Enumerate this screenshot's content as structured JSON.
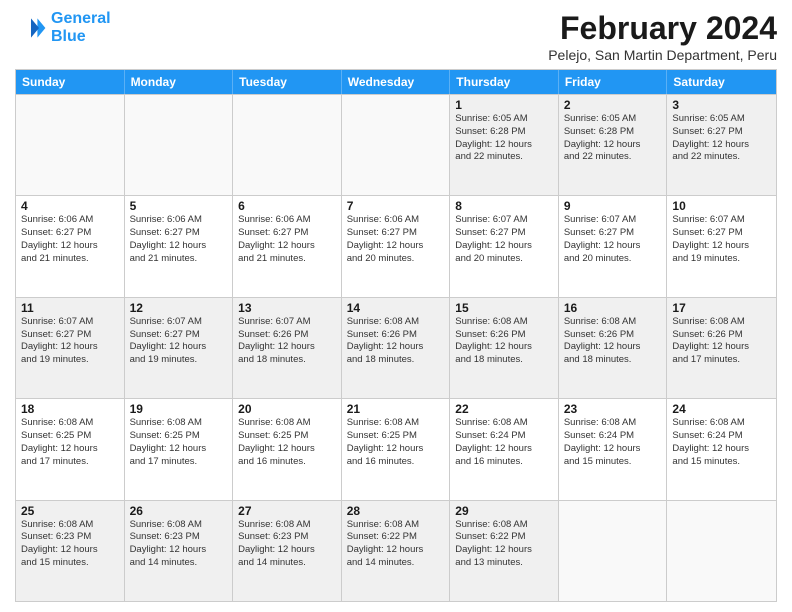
{
  "logo": {
    "line1": "General",
    "line2": "Blue"
  },
  "title": "February 2024",
  "subtitle": "Pelejo, San Martin Department, Peru",
  "weekdays": [
    "Sunday",
    "Monday",
    "Tuesday",
    "Wednesday",
    "Thursday",
    "Friday",
    "Saturday"
  ],
  "weeks": [
    [
      {
        "day": "",
        "info": "",
        "empty": true
      },
      {
        "day": "",
        "info": "",
        "empty": true
      },
      {
        "day": "",
        "info": "",
        "empty": true
      },
      {
        "day": "",
        "info": "",
        "empty": true
      },
      {
        "day": "1",
        "info": "Sunrise: 6:05 AM\nSunset: 6:28 PM\nDaylight: 12 hours\nand 22 minutes."
      },
      {
        "day": "2",
        "info": "Sunrise: 6:05 AM\nSunset: 6:28 PM\nDaylight: 12 hours\nand 22 minutes."
      },
      {
        "day": "3",
        "info": "Sunrise: 6:05 AM\nSunset: 6:27 PM\nDaylight: 12 hours\nand 22 minutes."
      }
    ],
    [
      {
        "day": "4",
        "info": "Sunrise: 6:06 AM\nSunset: 6:27 PM\nDaylight: 12 hours\nand 21 minutes."
      },
      {
        "day": "5",
        "info": "Sunrise: 6:06 AM\nSunset: 6:27 PM\nDaylight: 12 hours\nand 21 minutes."
      },
      {
        "day": "6",
        "info": "Sunrise: 6:06 AM\nSunset: 6:27 PM\nDaylight: 12 hours\nand 21 minutes."
      },
      {
        "day": "7",
        "info": "Sunrise: 6:06 AM\nSunset: 6:27 PM\nDaylight: 12 hours\nand 20 minutes."
      },
      {
        "day": "8",
        "info": "Sunrise: 6:07 AM\nSunset: 6:27 PM\nDaylight: 12 hours\nand 20 minutes."
      },
      {
        "day": "9",
        "info": "Sunrise: 6:07 AM\nSunset: 6:27 PM\nDaylight: 12 hours\nand 20 minutes."
      },
      {
        "day": "10",
        "info": "Sunrise: 6:07 AM\nSunset: 6:27 PM\nDaylight: 12 hours\nand 19 minutes."
      }
    ],
    [
      {
        "day": "11",
        "info": "Sunrise: 6:07 AM\nSunset: 6:27 PM\nDaylight: 12 hours\nand 19 minutes."
      },
      {
        "day": "12",
        "info": "Sunrise: 6:07 AM\nSunset: 6:27 PM\nDaylight: 12 hours\nand 19 minutes."
      },
      {
        "day": "13",
        "info": "Sunrise: 6:07 AM\nSunset: 6:26 PM\nDaylight: 12 hours\nand 18 minutes."
      },
      {
        "day": "14",
        "info": "Sunrise: 6:08 AM\nSunset: 6:26 PM\nDaylight: 12 hours\nand 18 minutes."
      },
      {
        "day": "15",
        "info": "Sunrise: 6:08 AM\nSunset: 6:26 PM\nDaylight: 12 hours\nand 18 minutes."
      },
      {
        "day": "16",
        "info": "Sunrise: 6:08 AM\nSunset: 6:26 PM\nDaylight: 12 hours\nand 18 minutes."
      },
      {
        "day": "17",
        "info": "Sunrise: 6:08 AM\nSunset: 6:26 PM\nDaylight: 12 hours\nand 17 minutes."
      }
    ],
    [
      {
        "day": "18",
        "info": "Sunrise: 6:08 AM\nSunset: 6:25 PM\nDaylight: 12 hours\nand 17 minutes."
      },
      {
        "day": "19",
        "info": "Sunrise: 6:08 AM\nSunset: 6:25 PM\nDaylight: 12 hours\nand 17 minutes."
      },
      {
        "day": "20",
        "info": "Sunrise: 6:08 AM\nSunset: 6:25 PM\nDaylight: 12 hours\nand 16 minutes."
      },
      {
        "day": "21",
        "info": "Sunrise: 6:08 AM\nSunset: 6:25 PM\nDaylight: 12 hours\nand 16 minutes."
      },
      {
        "day": "22",
        "info": "Sunrise: 6:08 AM\nSunset: 6:24 PM\nDaylight: 12 hours\nand 16 minutes."
      },
      {
        "day": "23",
        "info": "Sunrise: 6:08 AM\nSunset: 6:24 PM\nDaylight: 12 hours\nand 15 minutes."
      },
      {
        "day": "24",
        "info": "Sunrise: 6:08 AM\nSunset: 6:24 PM\nDaylight: 12 hours\nand 15 minutes."
      }
    ],
    [
      {
        "day": "25",
        "info": "Sunrise: 6:08 AM\nSunset: 6:23 PM\nDaylight: 12 hours\nand 15 minutes."
      },
      {
        "day": "26",
        "info": "Sunrise: 6:08 AM\nSunset: 6:23 PM\nDaylight: 12 hours\nand 14 minutes."
      },
      {
        "day": "27",
        "info": "Sunrise: 6:08 AM\nSunset: 6:23 PM\nDaylight: 12 hours\nand 14 minutes."
      },
      {
        "day": "28",
        "info": "Sunrise: 6:08 AM\nSunset: 6:22 PM\nDaylight: 12 hours\nand 14 minutes."
      },
      {
        "day": "29",
        "info": "Sunrise: 6:08 AM\nSunset: 6:22 PM\nDaylight: 12 hours\nand 13 minutes."
      },
      {
        "day": "",
        "info": "",
        "empty": true
      },
      {
        "day": "",
        "info": "",
        "empty": true
      }
    ]
  ]
}
